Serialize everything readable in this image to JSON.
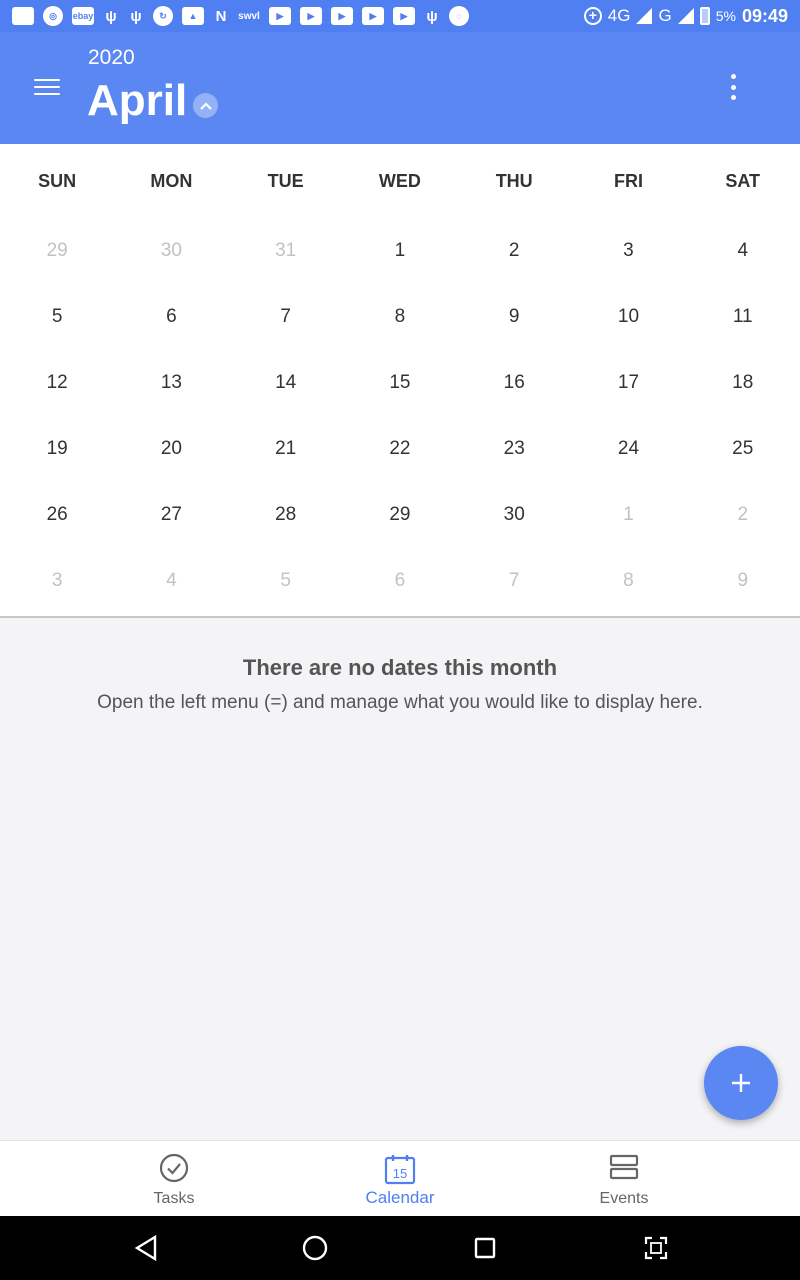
{
  "status_bar": {
    "icons": [
      "app-icon",
      "chrome-icon",
      "ebay",
      "usb-icon",
      "usb-icon",
      "sync-icon",
      "image-icon",
      "nav-icon",
      "swvl",
      "youtube-icon",
      "youtube-icon",
      "youtube-icon",
      "youtube-icon",
      "youtube-icon",
      "usb-icon",
      "app-icon"
    ],
    "ebay_label": "ebay",
    "swvl_label": "swvl",
    "network_4g": "4G",
    "network_g": "G",
    "battery": "5%",
    "time": "09:49"
  },
  "header": {
    "year": "2020",
    "month": "April"
  },
  "calendar": {
    "weekdays": [
      "SUN",
      "MON",
      "TUE",
      "WED",
      "THU",
      "FRI",
      "SAT"
    ],
    "weeks": [
      [
        {
          "d": "29",
          "m": true
        },
        {
          "d": "30",
          "m": true
        },
        {
          "d": "31",
          "m": true
        },
        {
          "d": "1"
        },
        {
          "d": "2"
        },
        {
          "d": "3"
        },
        {
          "d": "4"
        }
      ],
      [
        {
          "d": "5"
        },
        {
          "d": "6"
        },
        {
          "d": "7"
        },
        {
          "d": "8"
        },
        {
          "d": "9"
        },
        {
          "d": "10"
        },
        {
          "d": "11"
        }
      ],
      [
        {
          "d": "12"
        },
        {
          "d": "13"
        },
        {
          "d": "14"
        },
        {
          "d": "15"
        },
        {
          "d": "16"
        },
        {
          "d": "17"
        },
        {
          "d": "18"
        }
      ],
      [
        {
          "d": "19"
        },
        {
          "d": "20"
        },
        {
          "d": "21"
        },
        {
          "d": "22"
        },
        {
          "d": "23"
        },
        {
          "d": "24"
        },
        {
          "d": "25"
        }
      ],
      [
        {
          "d": "26"
        },
        {
          "d": "27"
        },
        {
          "d": "28"
        },
        {
          "d": "29"
        },
        {
          "d": "30"
        },
        {
          "d": "1",
          "m": true
        },
        {
          "d": "2",
          "m": true
        }
      ],
      [
        {
          "d": "3",
          "m": true
        },
        {
          "d": "4",
          "m": true
        },
        {
          "d": "5",
          "m": true
        },
        {
          "d": "6",
          "m": true
        },
        {
          "d": "7",
          "m": true
        },
        {
          "d": "8",
          "m": true
        },
        {
          "d": "9",
          "m": true
        }
      ]
    ]
  },
  "empty_state": {
    "title": "There are no dates this month",
    "message": "Open the left menu (=) and manage what you would like to display here."
  },
  "bottom_nav": {
    "tasks": "Tasks",
    "calendar": "Calendar",
    "calendar_icon_day": "15",
    "events": "Events",
    "active": "calendar"
  },
  "colors": {
    "accent": "#5a87f2",
    "status_bar": "#4f7ff0",
    "muted_day": "#c2c2c2"
  }
}
